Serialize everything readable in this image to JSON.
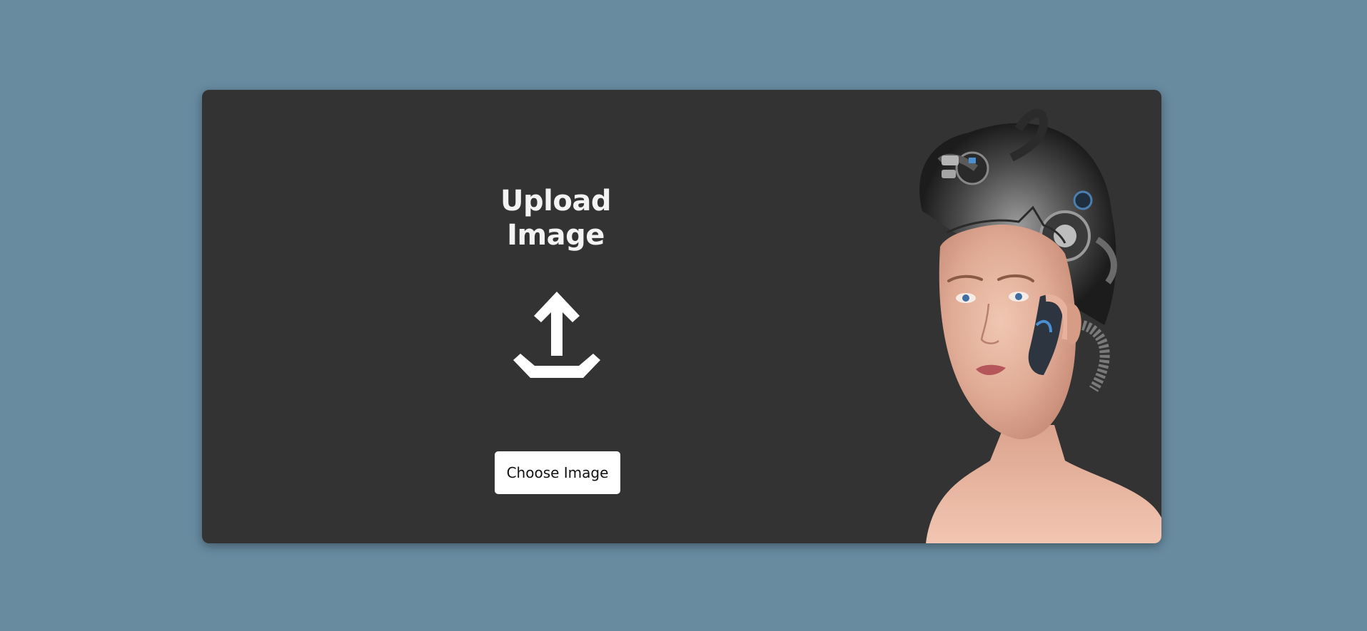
{
  "page": {
    "background_color": "#688ba0",
    "card_color": "#333333"
  },
  "upload": {
    "title": "Upload Image",
    "icon": "upload-icon",
    "button_label": "Choose Image"
  },
  "illustration": {
    "subject": "cyborg-portrait"
  }
}
